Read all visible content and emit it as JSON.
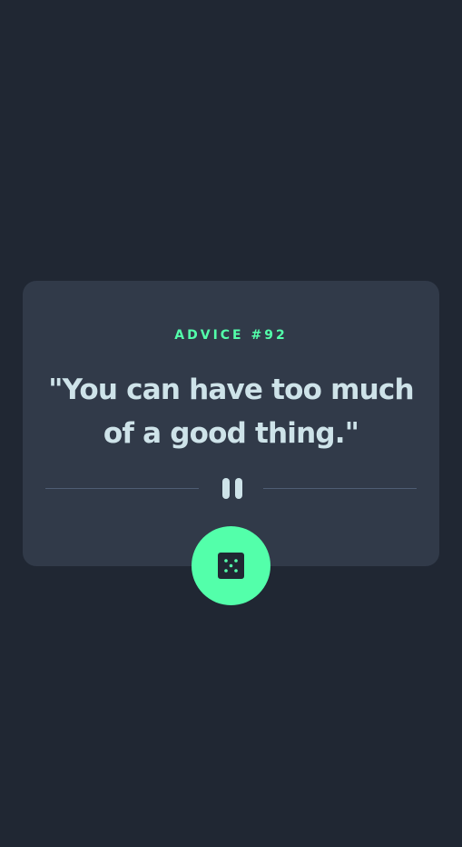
{
  "card": {
    "advice_label": "ADVICE #92",
    "advice_text": "\"You can have too much of a good thing.\""
  },
  "dice_button": {
    "icon": "dice-icon"
  },
  "colors": {
    "background": "#202733",
    "card": "#313a49",
    "accent": "#53ffaa",
    "text": "#cee3e9",
    "divider": "#4f5d74"
  }
}
